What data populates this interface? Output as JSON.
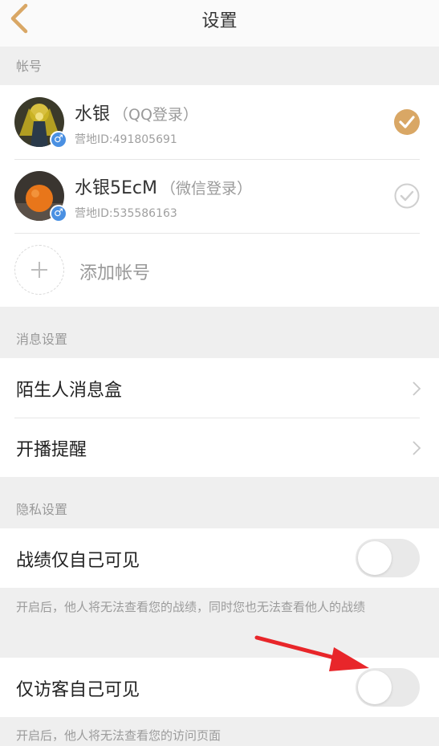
{
  "nav": {
    "title": "设置"
  },
  "sections": {
    "account": "帐号",
    "message": "消息设置",
    "privacy": "隐私设置"
  },
  "accounts": [
    {
      "name": "水银",
      "login_type": "（QQ登录）",
      "id_text": "营地ID:491805691",
      "selected": true,
      "gender": "♂"
    },
    {
      "name": "水银5EcM",
      "login_type": "（微信登录）",
      "id_text": "营地ID:535586163",
      "selected": false,
      "gender": "♂"
    }
  ],
  "add_account": {
    "label": "添加帐号"
  },
  "message_settings": [
    {
      "label": "陌生人消息盒"
    },
    {
      "label": "开播提醒"
    }
  ],
  "privacy_settings": [
    {
      "label": "战绩仅自己可见",
      "on": false,
      "note": "开启后，他人将无法查看您的战绩，同时您也无法查看他人的战绩"
    },
    {
      "label": "仅访客自己可见",
      "on": false,
      "note": "开启后，他人将无法查看您的访问页面"
    }
  ],
  "colors": {
    "accent": "#d9a765",
    "toggle_off": "#e9e9e9",
    "arrow": "#e8262a",
    "badge": "#4a90e2"
  }
}
